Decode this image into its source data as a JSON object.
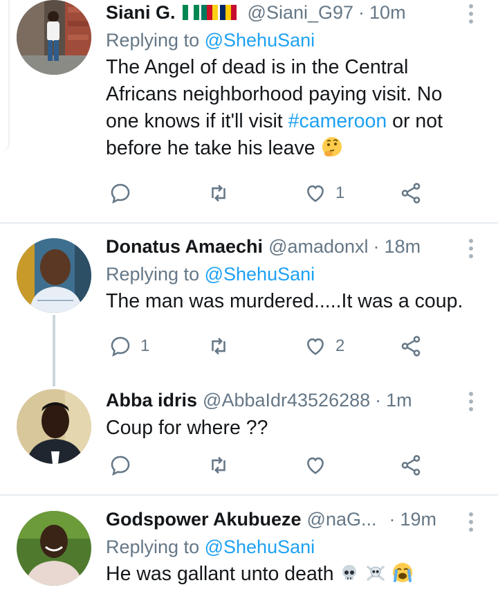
{
  "tweets": [
    {
      "name": "Siani G.",
      "handle": "@Siani_G97",
      "time": "10m",
      "replying_prefix": "Replying to",
      "replying_handle": "@ShehuSani",
      "body_1": "The Angel of dead is in the Central Africans neighborhood paying visit. No one knows if it'll visit",
      "hashtag": "#cameroon",
      "body_2": "or not before he take his leave",
      "reply_count": "",
      "retweet_count": "",
      "like_count": "1"
    },
    {
      "name": "Donatus Amaechi",
      "handle": "@amadonxl",
      "time": "18m",
      "replying_prefix": "Replying to",
      "replying_handle": "@ShehuSani",
      "body": "The man was murdered.....It was a coup.",
      "reply_count": "1",
      "retweet_count": "",
      "like_count": "2"
    },
    {
      "name": "Abba idris",
      "handle": "@AbbaIdr43526288",
      "time": "1m",
      "body": "Coup for where ??",
      "reply_count": "",
      "retweet_count": "",
      "like_count": ""
    },
    {
      "name": "Godspower Akubueze",
      "handle": "@naG...",
      "time": "19m",
      "replying_prefix": "Replying to",
      "replying_handle": "@ShehuSani",
      "body": "He was gallant unto death"
    }
  ],
  "separator": "·",
  "icons": {
    "reply": "reply-icon",
    "retweet": "retweet-icon",
    "like": "heart-icon",
    "share": "share-icon",
    "more": "more-vertical-icon",
    "thinking": "thinking-face-emoji",
    "skull": "skull-emoji",
    "crossbones": "skull-and-crossbones-emoji",
    "crying": "loudly-crying-face-emoji"
  },
  "colors": {
    "link": "#1da1f2",
    "secondary_text": "#657786",
    "icon": "#657786",
    "divider": "#e6ecf0",
    "thread_line": "#ccd6dd"
  }
}
